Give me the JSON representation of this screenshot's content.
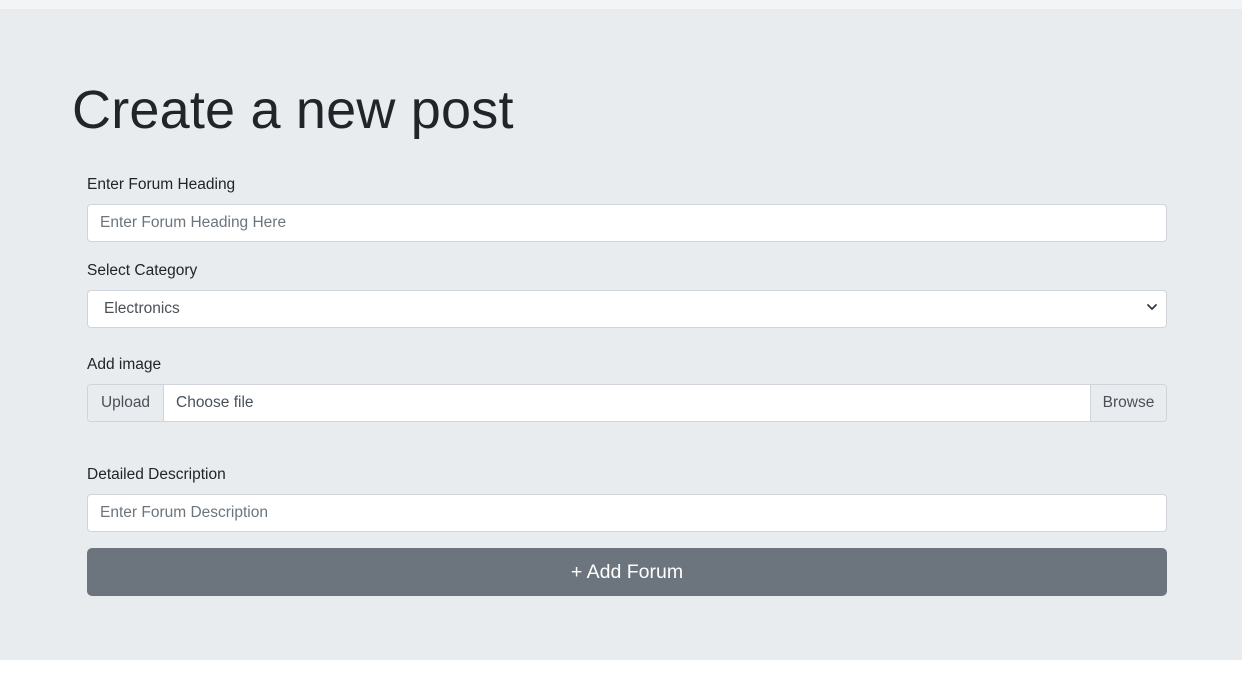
{
  "page": {
    "title": "Create a new post"
  },
  "form": {
    "heading": {
      "label": "Enter Forum Heading",
      "placeholder": "Enter Forum Heading Here",
      "value": ""
    },
    "category": {
      "label": "Select Category",
      "selected": "Electronics"
    },
    "image": {
      "label": "Add image",
      "prepend": "Upload",
      "file_label": "Choose file",
      "browse": "Browse"
    },
    "description": {
      "label": "Detailed Description",
      "placeholder": "Enter Forum Description",
      "value": ""
    },
    "submit": {
      "label": "+ Add Forum"
    }
  },
  "colors": {
    "jumbotron_bg": "#e9ecef",
    "button_bg": "#6c757d",
    "text": "#212529"
  },
  "icons": {
    "select_arrow": "chevron-down-icon"
  }
}
